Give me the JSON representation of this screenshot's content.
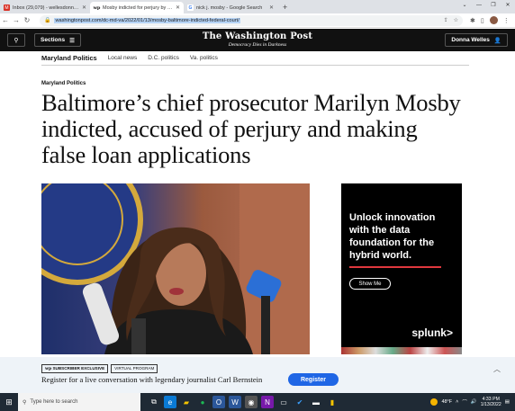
{
  "browser": {
    "tabs": [
      {
        "title": "Inbox (29,079) - wellesdonnelle@...",
        "active": false,
        "favicon": "gmail-icon",
        "color": "#d93025"
      },
      {
        "title": "Mosby indicted for perjury by fe...",
        "active": true,
        "favicon": "wapo-icon",
        "color": "#111111"
      },
      {
        "title": "nick j. mosby - Google Search",
        "active": false,
        "favicon": "google-icon",
        "color": "#4285f4"
      }
    ],
    "new_tab": "+",
    "url": "washingtonpost.com/dc-md-va/2022/01/13/mosby-baltimore-indicted-federal-court/"
  },
  "wapo": {
    "search_icon": "search-icon",
    "sections_label": "Sections",
    "logo": "The Washington Post",
    "tagline": "Democracy Dies in Darkness",
    "user_label": "Donna Welles"
  },
  "section_nav": {
    "main": "Maryland Politics",
    "links": [
      "Local news",
      "D.C. politics",
      "Va. politics"
    ]
  },
  "article": {
    "kicker": "Maryland Politics",
    "headline": "Baltimore’s chief prosecutor Marilyn Mosby indicted, accused of perjury and making false loan applications"
  },
  "ad": {
    "text": "Unlock innovation with the data foundation for the hybrid world.",
    "button": "Show Me",
    "brand": "splunk>",
    "accent": "#e0383e"
  },
  "promo": {
    "badge1": "SUBSCRIBER EXCLUSIVE",
    "badge2": "VIRTUAL PROGRAM",
    "text": "Register for a live conversation with legendary journalist Carl Bernstein",
    "button": "Register",
    "accent": "#1f66e5"
  },
  "taskbar": {
    "search_placeholder": "Type here to search",
    "temperature": "48°F",
    "time": "4:33 PM",
    "date": "1/13/2022"
  }
}
